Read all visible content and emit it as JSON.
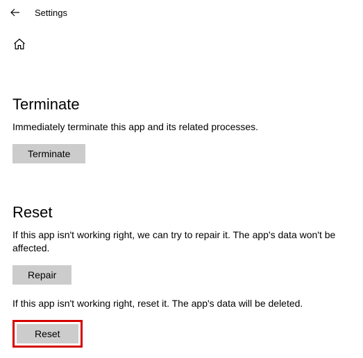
{
  "header": {
    "title": "Settings"
  },
  "sections": {
    "terminate": {
      "heading": "Terminate",
      "description": "Immediately terminate this app and its related processes.",
      "button_label": "Terminate"
    },
    "reset": {
      "heading": "Reset",
      "repair_description": "If this app isn't working right, we can try to repair it. The app's data won't be affected.",
      "repair_button_label": "Repair",
      "reset_description": "If this app isn't working right, reset it. The app's data will be deleted.",
      "reset_button_label": "Reset"
    }
  }
}
